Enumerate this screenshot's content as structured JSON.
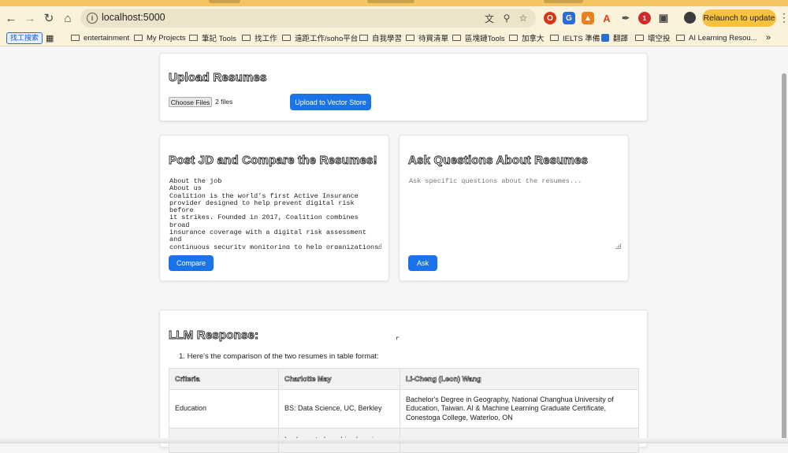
{
  "browser": {
    "url": "localhost:5000",
    "relaunch_label": "Relaunch to update",
    "extension_badge": "1",
    "icons": [
      "back-icon",
      "forward-icon",
      "reload-icon",
      "home-icon",
      "info-icon",
      "translate-icon",
      "zoom-icon",
      "star-icon",
      "menu-icon"
    ]
  },
  "bookmarks": {
    "tag": "找工搜索",
    "items": [
      {
        "label": "entertainment"
      },
      {
        "label": "My Projects"
      },
      {
        "label": "筆記 Tools"
      },
      {
        "label": "找工作"
      },
      {
        "label": "遠距工作/soho平台"
      },
      {
        "label": "自我學習"
      },
      {
        "label": "待買清單"
      },
      {
        "label": "區塊鏈Tools"
      },
      {
        "label": "加拿大"
      },
      {
        "label": "IELTS 準備"
      },
      {
        "label": "翻譯"
      },
      {
        "label": "壞空投"
      },
      {
        "label": "AI Learning Resou..."
      }
    ],
    "more": "»"
  },
  "upload": {
    "title": "Upload Resumes",
    "choose_label": "Choose Files",
    "file_count": "2 files",
    "upload_button": "Upload to Vector Store"
  },
  "compare": {
    "title": "Post JD and Compare the Resumes!",
    "jd_text": "About the job\nAbout us\nCoalition is the world’s first Active Insurance\nprovider designed to help prevent digital risk before\nit strikes. Founded in 2017, Coalition combines broad\ninsurance coverage with a digital risk assessment and\ncontinuous security monitoring to help organizations\nprotect themselves in today’s hyper–connected world.",
    "button": "Compare"
  },
  "ask": {
    "title": "Ask Questions About Resumes",
    "placeholder": "Ask specific questions about the resumes...",
    "button": "Ask"
  },
  "response": {
    "title": "LLM Response:",
    "list_number": "1.",
    "intro": "Here's the comparison of the two resumes in table format:",
    "headers": [
      "Criteria",
      "Charlotte May",
      "Li-Cheng (Leon) Wang"
    ],
    "rows": [
      [
        "Education",
        "BS: Data Science, UC, Berkley",
        "Bachelor's Degree in Geography, National Changhua University of Education, Taiwan. AI & Machine Learning Graduate Certificate, Conestoga College, Waterloo, ON"
      ],
      [
        "",
        "Implemented machine learning",
        ""
      ]
    ]
  }
}
